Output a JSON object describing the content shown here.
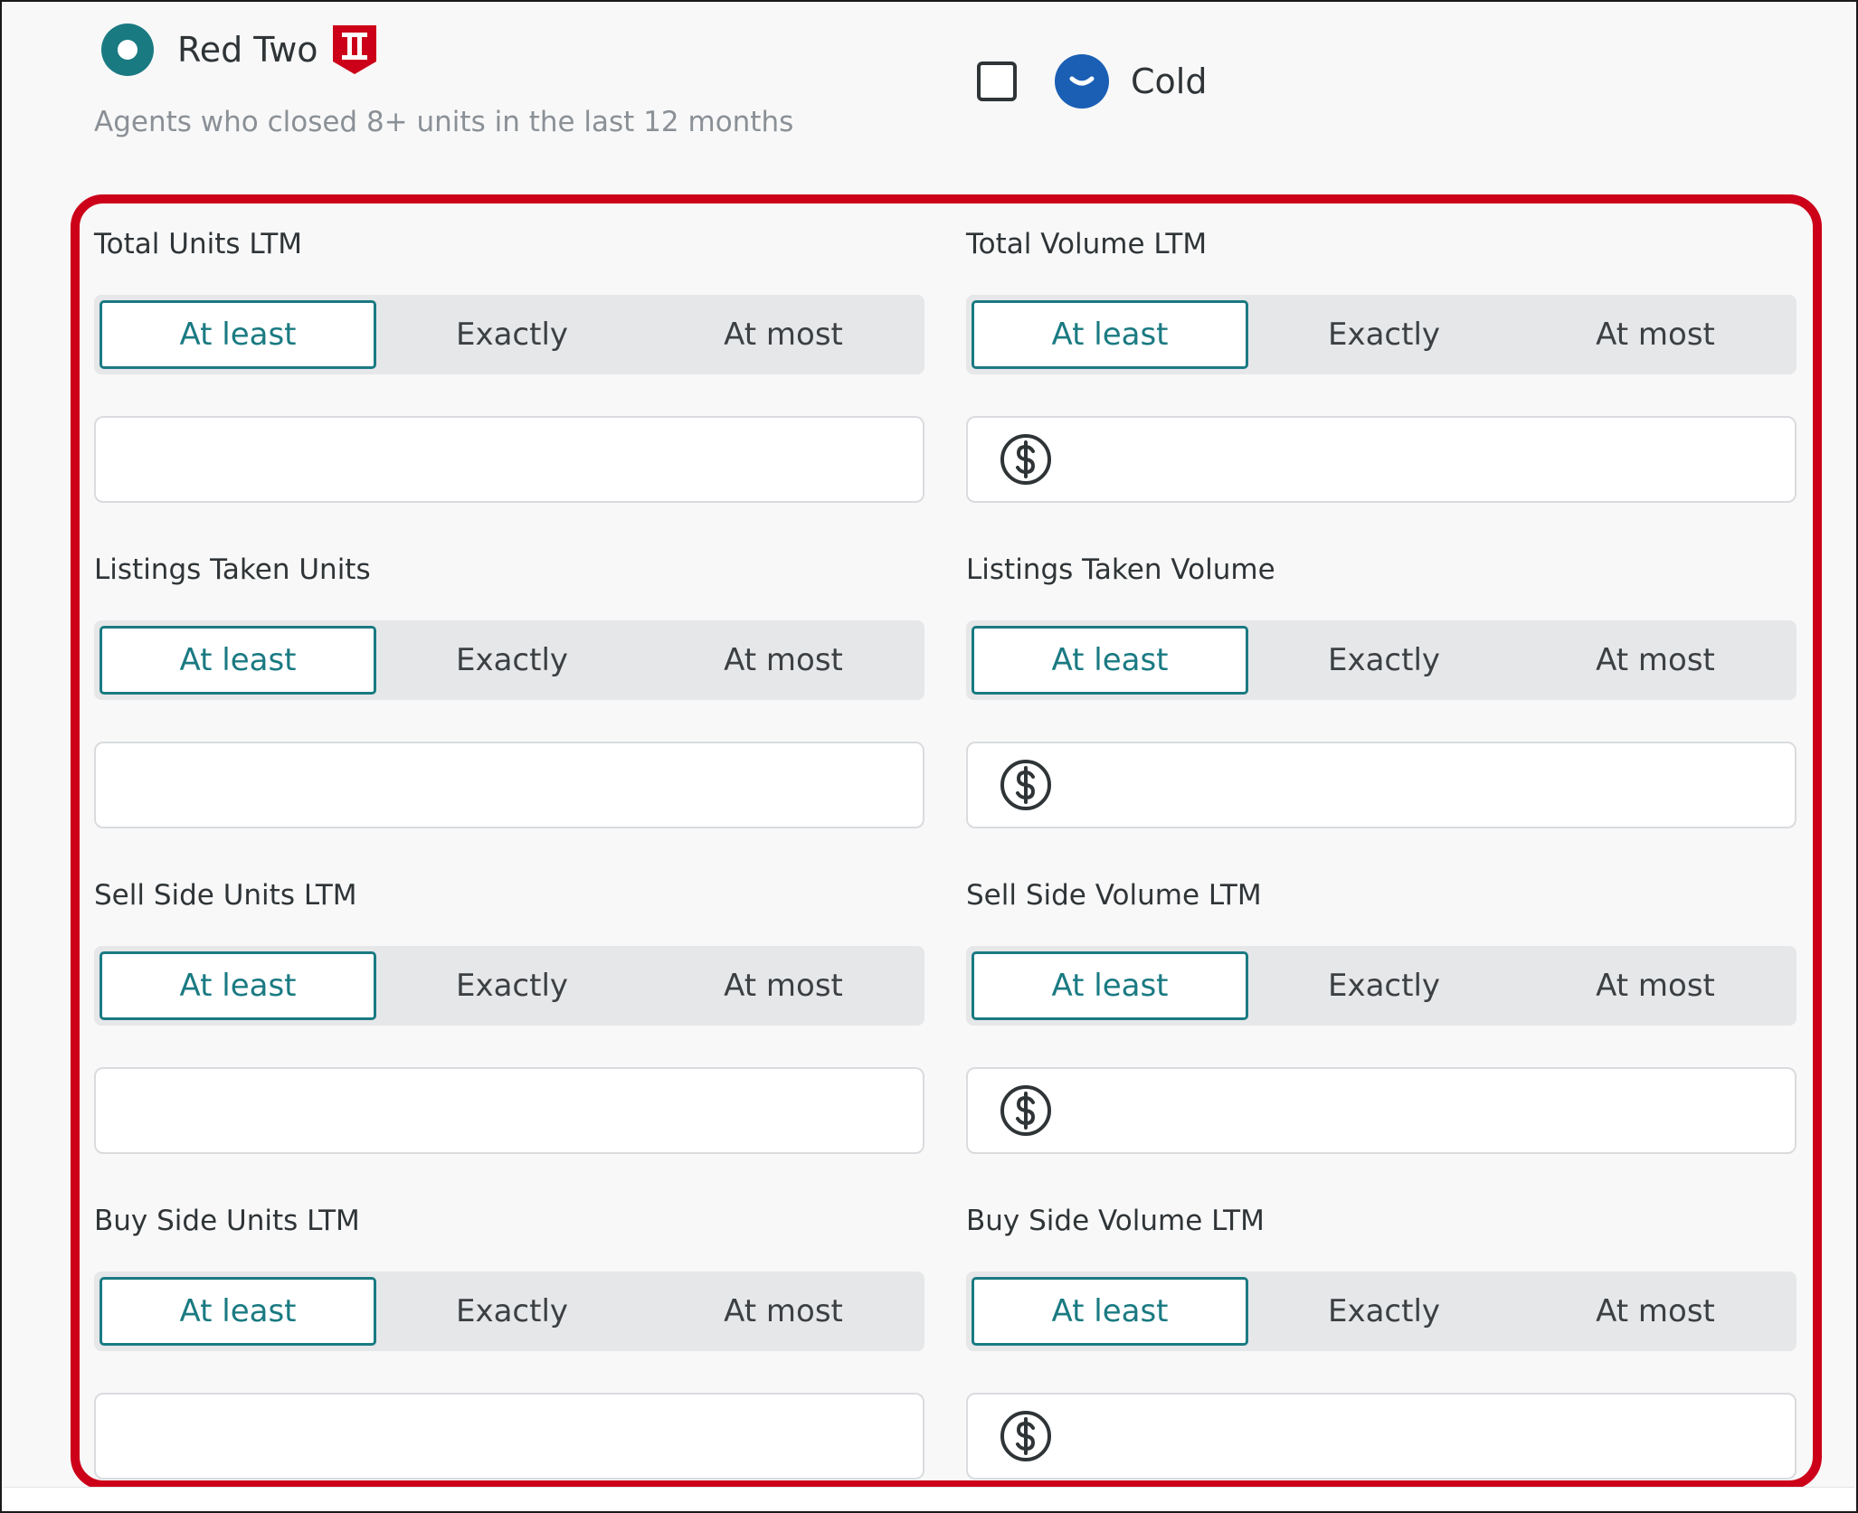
{
  "header": {
    "segment_name": "Red Two",
    "segment_description": "Agents who closed 8+ units in the last 12 months",
    "temperature_label": "Cold",
    "badge_icon": "red-two-shield-icon",
    "temperature_icon": "chevron-down-circle-icon"
  },
  "colors": {
    "accent": "#1a7a82",
    "highlight": "#cc0018",
    "badge": "#cc0018",
    "cold": "#1a5fb4"
  },
  "comparators": [
    "At least",
    "Exactly",
    "At most"
  ],
  "fields": [
    {
      "label": "Total Units LTM",
      "selected": "At least",
      "value": "",
      "currency": false
    },
    {
      "label": "Total Volume LTM",
      "selected": "At least",
      "value": "",
      "currency": true
    },
    {
      "label": "Listings Taken Units",
      "selected": "At least",
      "value": "",
      "currency": false
    },
    {
      "label": "Listings Taken Volume",
      "selected": "At least",
      "value": "",
      "currency": true
    },
    {
      "label": "Sell Side Units LTM",
      "selected": "At least",
      "value": "",
      "currency": false
    },
    {
      "label": "Sell Side Volume LTM",
      "selected": "At least",
      "value": "",
      "currency": true
    },
    {
      "label": "Buy Side Units LTM",
      "selected": "At least",
      "value": "",
      "currency": false
    },
    {
      "label": "Buy Side Volume LTM",
      "selected": "At least",
      "value": "",
      "currency": true
    }
  ]
}
